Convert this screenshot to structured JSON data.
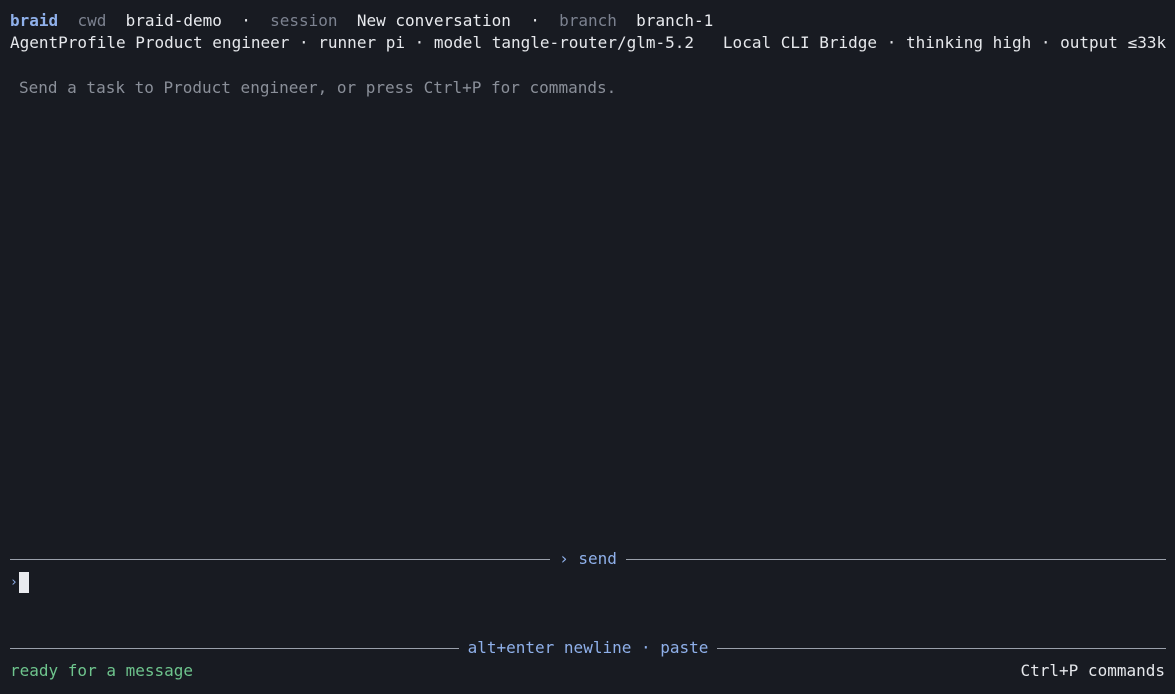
{
  "header": {
    "app_name": "braid",
    "cwd_label": "cwd",
    "cwd_value": "braid-demo",
    "separator": "·",
    "session_label": "session",
    "session_value": "New conversation",
    "branch_label": "branch",
    "branch_value": "branch-1"
  },
  "profile_line": {
    "profile_label": "AgentProfile",
    "profile_value": "Product engineer",
    "separator": "·",
    "runner_label": "runner",
    "runner_value": "pi",
    "model_label": "model",
    "model_value": "tangle-router/glm-5.2",
    "bridge": "Local CLI Bridge",
    "thinking_label": "thinking",
    "thinking_value": "high",
    "output_label": "output",
    "output_value": "≤33k"
  },
  "main": {
    "placeholder": "Send a task to Product engineer, or press Ctrl+P for commands."
  },
  "composer": {
    "send_label": "› send",
    "prompt_glyph": "›",
    "input_value": ""
  },
  "footer": {
    "hint_label": "alt+enter newline · paste",
    "status_text": "ready for a message",
    "shortcut_text": "Ctrl+P commands"
  },
  "colors": {
    "background": "#181b22",
    "accent": "#8fb0ea",
    "status_green": "#6ec48d",
    "muted": "#7c8290"
  }
}
